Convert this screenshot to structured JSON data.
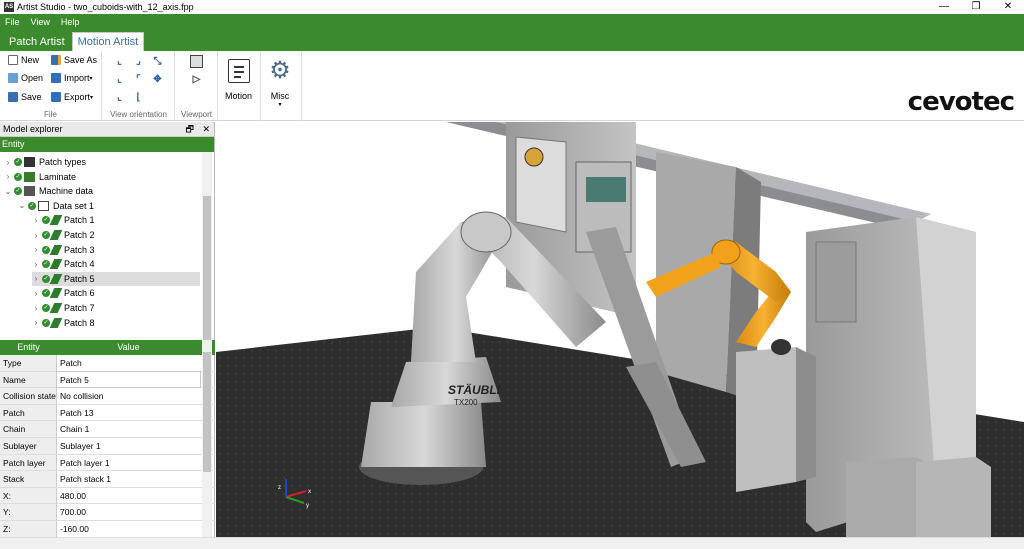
{
  "window": {
    "title": "Artist Studio - two_cuboids-with_12_axis.fpp",
    "icon_label": "AS",
    "controls": [
      "—",
      "❐",
      "✕"
    ]
  },
  "menu": [
    "File",
    "View",
    "Help"
  ],
  "tabs": [
    {
      "label": "Patch Artist",
      "active": false
    },
    {
      "label": "Motion Artist",
      "active": true
    }
  ],
  "ribbon": {
    "file": {
      "label": "File",
      "new": "New",
      "open": "Open",
      "save": "Save",
      "save_as": "Save As",
      "import": "Import",
      "export": "Export"
    },
    "view_orientation": {
      "label": "View orientation"
    },
    "viewport": {
      "label": "Viewport"
    },
    "motion": {
      "label": "Motion"
    },
    "misc": {
      "label": "Misc"
    },
    "brand": "cevotec"
  },
  "model_explorer": {
    "title": "Model explorer",
    "column": "Entity",
    "tree": [
      {
        "label": "Patch types",
        "level": 0,
        "icon": "patch-types-icon"
      },
      {
        "label": "Laminate",
        "level": 0,
        "icon": "laminate-icon"
      },
      {
        "label": "Machine data",
        "level": 0,
        "icon": "machine-data-icon",
        "expanded": true
      },
      {
        "label": "Data set 1",
        "level": 1,
        "icon": "folder-icon",
        "expanded": true
      },
      {
        "label": "Patch 1",
        "level": 2,
        "icon": "patch-icon"
      },
      {
        "label": "Patch 2",
        "level": 2,
        "icon": "patch-icon"
      },
      {
        "label": "Patch 3",
        "level": 2,
        "icon": "patch-icon"
      },
      {
        "label": "Patch 4",
        "level": 2,
        "icon": "patch-icon"
      },
      {
        "label": "Patch 5",
        "level": 2,
        "icon": "patch-icon",
        "selected": true
      },
      {
        "label": "Patch 6",
        "level": 2,
        "icon": "patch-icon"
      },
      {
        "label": "Patch 7",
        "level": 2,
        "icon": "patch-icon"
      },
      {
        "label": "Patch 8",
        "level": 2,
        "icon": "patch-icon"
      }
    ]
  },
  "properties": {
    "headers": [
      "Entity",
      "Value"
    ],
    "rows": [
      [
        "Type",
        "Patch"
      ],
      [
        "Name",
        "Patch 5"
      ],
      [
        "Collision state",
        "No collision"
      ],
      [
        "Patch",
        "Patch 13"
      ],
      [
        "Chain",
        "Chain 1"
      ],
      [
        "Sublayer",
        "Sublayer 1"
      ],
      [
        "Patch layer",
        "Patch layer 1"
      ],
      [
        "Stack",
        "Patch stack 1"
      ],
      [
        "X:",
        "480.00"
      ],
      [
        "Y:",
        "700.00"
      ],
      [
        "Z:",
        "-160.00"
      ]
    ]
  },
  "viewport": {
    "robot_brand": "STÄUBLI",
    "robot_model": "TX200",
    "axes": [
      "x",
      "y",
      "z"
    ]
  },
  "colors": {
    "accent": "#3c8a2e",
    "tab_active_text": "#2f6fb7",
    "robot_orange": "#f2a21a"
  }
}
